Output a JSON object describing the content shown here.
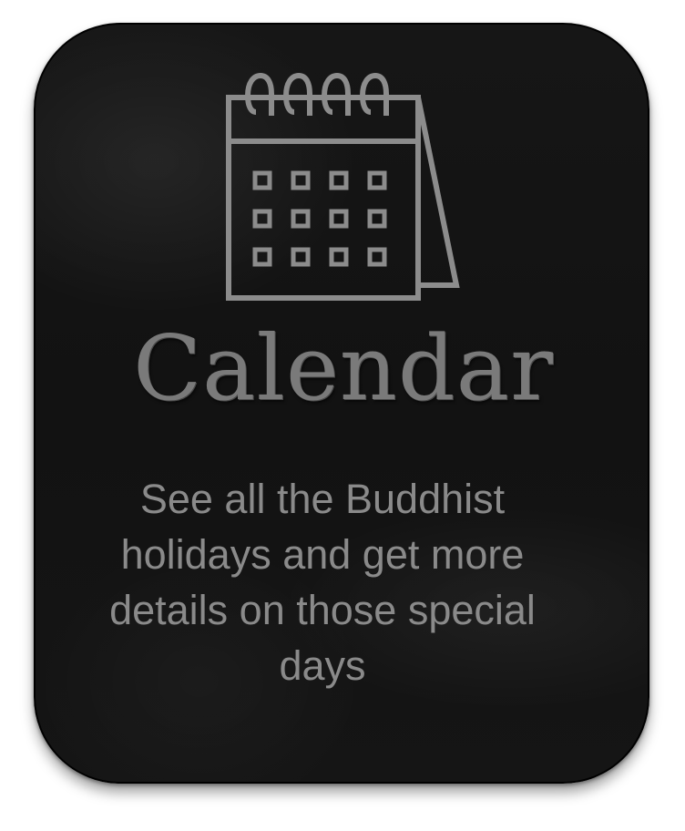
{
  "card": {
    "title": "Calendar",
    "description": "See all the Buddhist holidays and get more details on those special days",
    "icon": "calendar-icon"
  },
  "colors": {
    "card_background": "#141414",
    "card_border": "#000000",
    "title_text": "#7a7a7a",
    "description_text": "#8a8a8a",
    "icon_stroke": "#8c8c8c"
  }
}
